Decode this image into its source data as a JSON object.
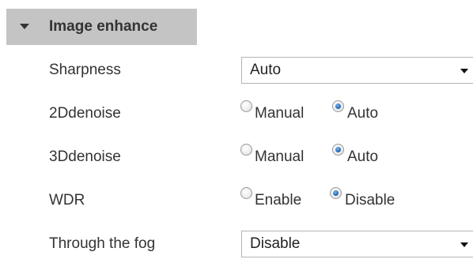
{
  "section": {
    "title": "Image enhance",
    "icon": "caret-down-icon"
  },
  "rows": [
    {
      "label": "Sharpness",
      "type": "select",
      "value": "Auto"
    },
    {
      "label": "2Ddenoise",
      "type": "radio",
      "options": [
        "Manual",
        "Auto"
      ],
      "selected": "Auto"
    },
    {
      "label": "3Ddenoise",
      "type": "radio",
      "options": [
        "Manual",
        "Auto"
      ],
      "selected": "Auto"
    },
    {
      "label": "WDR",
      "type": "radio",
      "options": [
        "Enable",
        "Disable"
      ],
      "selected": "Disable"
    },
    {
      "label": "Through the fog",
      "type": "select",
      "value": "Disable"
    }
  ],
  "colors": {
    "header_bg": "#c4c4c4",
    "radio_checked": "#2a6fc0"
  }
}
